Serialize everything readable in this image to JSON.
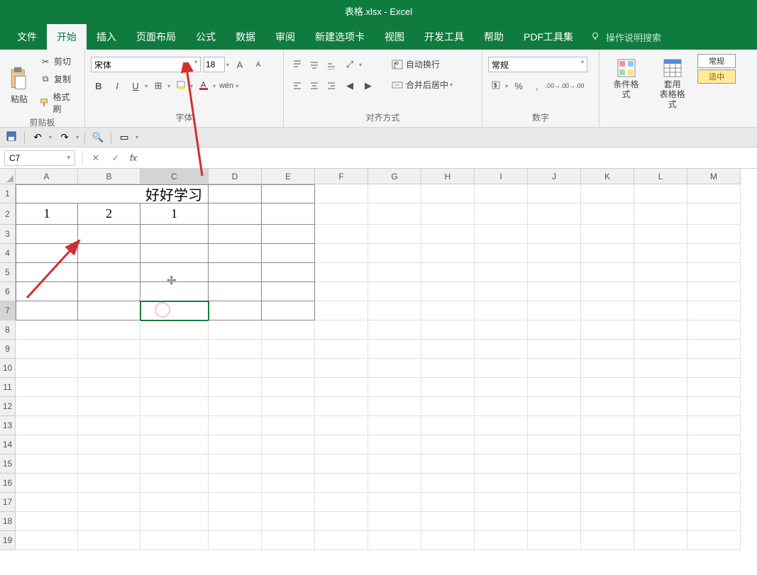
{
  "title": "表格.xlsx - Excel",
  "menu": {
    "file": "文件",
    "home": "开始",
    "insert": "插入",
    "layout": "页面布局",
    "formula": "公式",
    "data": "数据",
    "review": "审阅",
    "newtab": "新建选项卡",
    "view": "视图",
    "devtools": "开发工具",
    "help": "帮助",
    "pdf": "PDF工具集",
    "tellme": "操作说明搜索"
  },
  "ribbon": {
    "clipboard": {
      "label": "剪贴板",
      "paste": "粘贴",
      "cut": "剪切",
      "copy": "复制",
      "painter": "格式刷"
    },
    "font": {
      "label": "字体",
      "name": "宋体",
      "size": "18"
    },
    "align": {
      "label": "对齐方式",
      "wrap": "自动换行",
      "merge": "合并后居中"
    },
    "number": {
      "label": "数字",
      "format": "常规",
      "percent": "%",
      "comma": ","
    },
    "styles": {
      "condfmt": "条件格式",
      "tablefmt": "套用\n表格格式",
      "normal": "常规",
      "ok": "适中"
    }
  },
  "formula_bar": {
    "name_box": "C7",
    "fx": "fx",
    "value": ""
  },
  "columns": [
    "A",
    "B",
    "C",
    "D",
    "E",
    "F",
    "G",
    "H",
    "I",
    "J",
    "K",
    "L",
    "M"
  ],
  "rows": [
    "1",
    "2",
    "3",
    "4",
    "5",
    "6",
    "7",
    "8",
    "9",
    "10",
    "11",
    "12",
    "13",
    "14",
    "15",
    "16",
    "17",
    "18",
    "19"
  ],
  "cells": {
    "title_merged": "好好学习",
    "A2": "1",
    "B2": "2",
    "C2": "1"
  },
  "active_cell": {
    "row": 7,
    "col": "C"
  },
  "chart_data": null
}
